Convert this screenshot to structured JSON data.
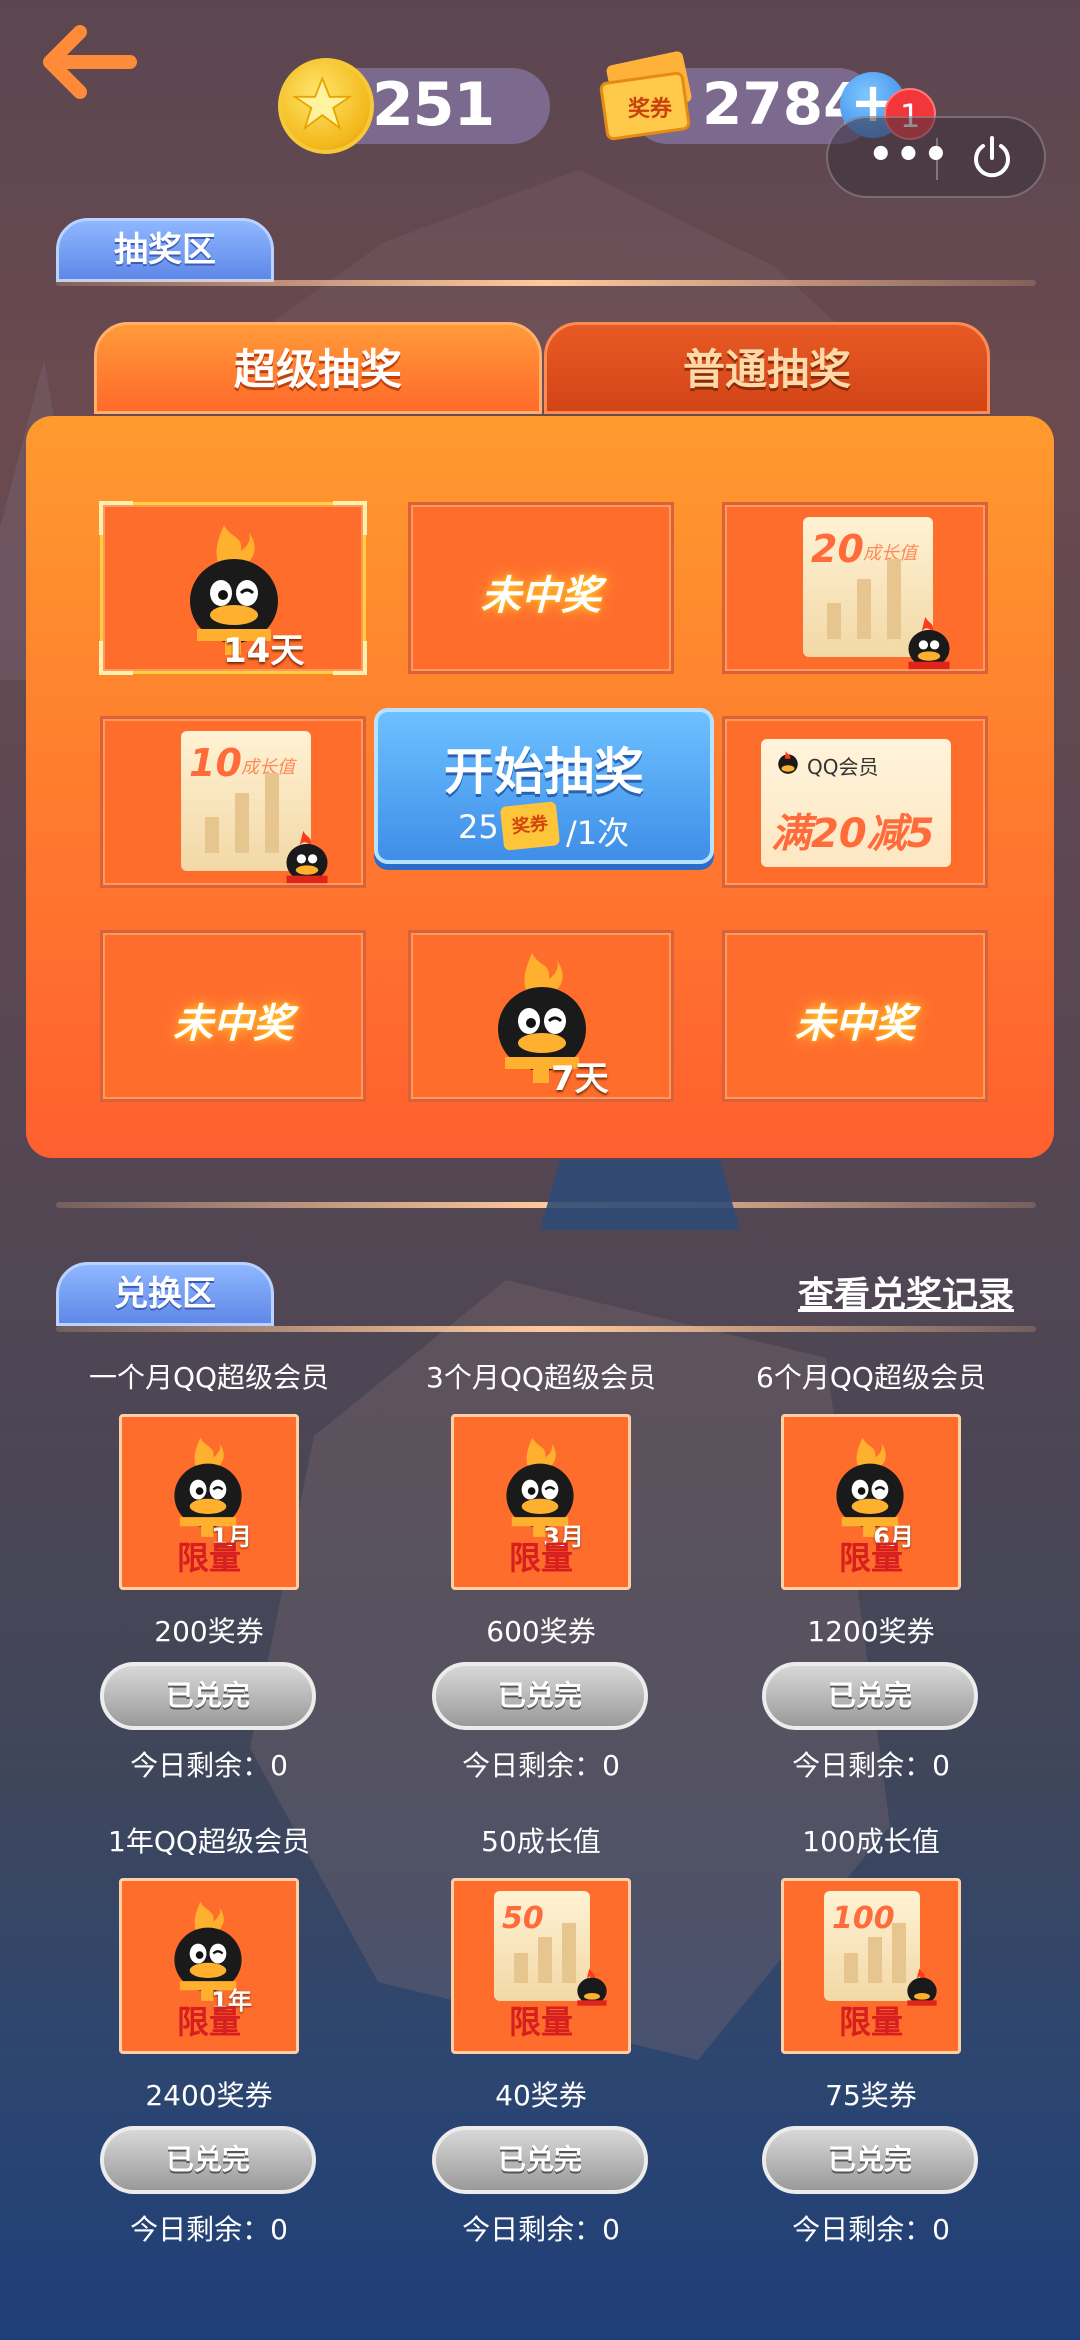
{
  "header": {
    "coins": "251",
    "tickets": "2784",
    "ticket_icon_label": "奖券",
    "plus_label": "+",
    "notification_count": "1"
  },
  "lottery": {
    "section_title": "抽奖区",
    "tabs": [
      "超级抽奖",
      "普通抽奖"
    ],
    "cells": [
      {
        "type": "vip",
        "label": "14天"
      },
      {
        "type": "lose",
        "label": "未中奖"
      },
      {
        "type": "growth",
        "value": "20",
        "unit": "成长值"
      },
      {
        "type": "growth",
        "value": "10",
        "unit": "成长值"
      },
      {
        "type": "coupon",
        "brand": "QQ会员",
        "offer": "满20减5"
      },
      {
        "type": "lose",
        "label": "未中奖"
      },
      {
        "type": "vip",
        "label": "7天"
      },
      {
        "type": "lose",
        "label": "未中奖"
      }
    ],
    "start": {
      "label": "开始抽奖",
      "cost": "25",
      "ticket_label": "奖券",
      "per": "/1次"
    }
  },
  "exchange": {
    "section_title": "兑换区",
    "record_link": "查看兑奖记录",
    "items": [
      {
        "title": "一个月QQ超级会员",
        "badge": "1月",
        "kind": "vip",
        "limit": "限量",
        "price": "200奖券",
        "button": "已兑完",
        "remain": "今日剩余：0"
      },
      {
        "title": "3个月QQ超级会员",
        "badge": "3月",
        "kind": "vip",
        "limit": "限量",
        "price": "600奖券",
        "button": "已兑完",
        "remain": "今日剩余：0"
      },
      {
        "title": "6个月QQ超级会员",
        "badge": "6月",
        "kind": "vip",
        "limit": "限量",
        "price": "1200奖券",
        "button": "已兑完",
        "remain": "今日剩余：0"
      },
      {
        "title": "1年QQ超级会员",
        "badge": "1年",
        "kind": "vip",
        "limit": "限量",
        "price": "2400奖券",
        "button": "已兑完",
        "remain": "今日剩余：0"
      },
      {
        "title": "50成长值",
        "badge": "50",
        "kind": "growth",
        "limit": "限量",
        "price": "40奖券",
        "button": "已兑完",
        "remain": "今日剩余：0"
      },
      {
        "title": "100成长值",
        "badge": "100",
        "kind": "growth",
        "limit": "限量",
        "price": "75奖券",
        "button": "已兑完",
        "remain": "今日剩余：0"
      }
    ]
  },
  "colors": {
    "accent_orange": "#ff6d2d",
    "tab_blue": "#6f9cf2",
    "button_blue": "#3f8ee8",
    "limit_red": "#d71f1f"
  },
  "icons": [
    "back-arrow-icon",
    "coin-icon",
    "ticket-icon",
    "plus-icon",
    "more-dots-icon",
    "power-icon",
    "penguin-icon"
  ]
}
